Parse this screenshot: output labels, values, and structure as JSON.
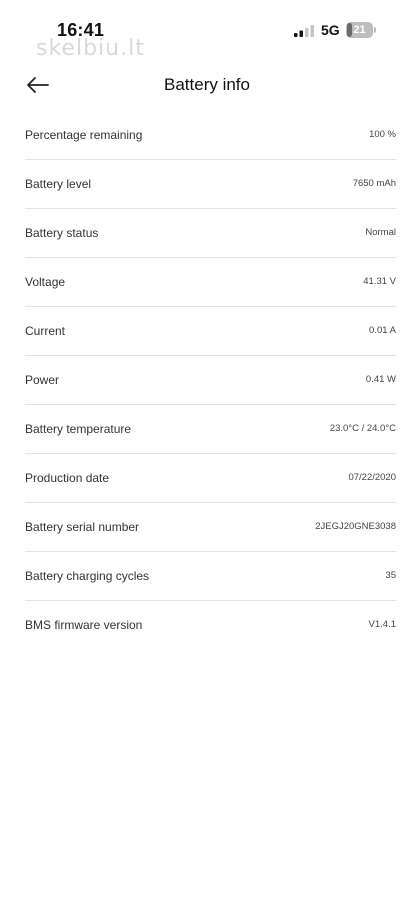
{
  "status_bar": {
    "time": "16:41",
    "watermark": "skelbiu.lt",
    "network": "5G",
    "battery_level": "21",
    "battery_fraction": 0.21
  },
  "header": {
    "title": "Battery info"
  },
  "rows": [
    {
      "label": "Percentage remaining",
      "value": "100 %"
    },
    {
      "label": "Battery level",
      "value": "7650 mAh"
    },
    {
      "label": "Battery status",
      "value": "Normal"
    },
    {
      "label": "Voltage",
      "value": "41.31 V"
    },
    {
      "label": "Current",
      "value": "0.01 A"
    },
    {
      "label": "Power",
      "value": "0.41 W"
    },
    {
      "label": "Battery temperature",
      "value": "23.0°C / 24.0°C"
    },
    {
      "label": "Production date",
      "value": "07/22/2020"
    },
    {
      "label": "Battery serial number",
      "value": "2JEGJ20GNE3038"
    },
    {
      "label": "Battery charging cycles",
      "value": "35"
    },
    {
      "label": "BMS firmware version",
      "value": "V1.4.1"
    }
  ],
  "icons": {
    "back": "arrow-left-icon",
    "signal": "cellular-signal-icon",
    "battery": "battery-icon"
  },
  "colors": {
    "background": "#ffffff",
    "divider": "#e3e3e3",
    "text": "#1a1a1a"
  }
}
